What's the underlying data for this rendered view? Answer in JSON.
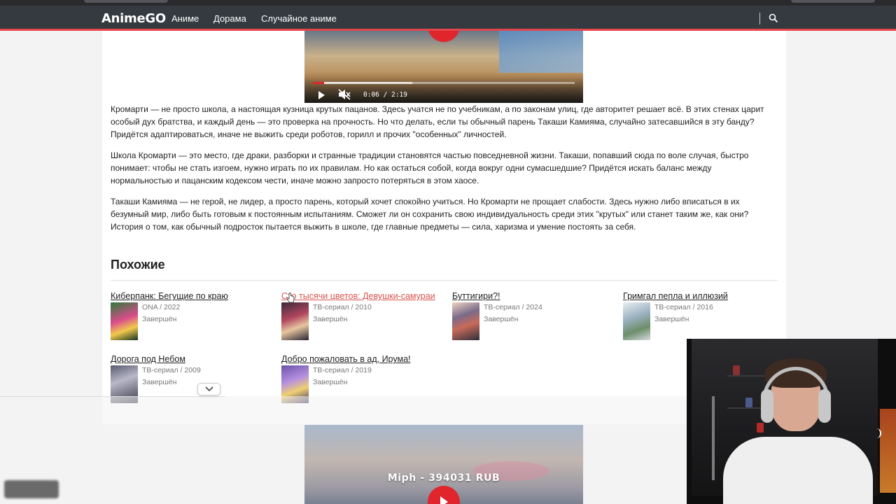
{
  "nav": {
    "brand": "AnimeGO",
    "links": [
      "Аниме",
      "Дорама",
      "Случайное аниме"
    ]
  },
  "player_top": {
    "time": "0:06 / 2:19",
    "progress": 0.043
  },
  "description": [
    "Кромарти — не просто школа, а настоящая кузница крутых пацанов. Здесь учатся не по учебникам, а по законам улиц, где авторитет решает всё. В этих стенах царит особый дух братства, и каждый день — это проверка на прочность. Но что делать, если ты обычный парень Такаши Камияма, случайно затесавшийся в эту банду? Придётся адаптироваться, иначе не выжить среди роботов, горилл и прочих \"особенных\" личностей.",
    "Школа Кромарти — это место, где драки, разборки и странные традиции становятся частью повседневной жизни. Такаши, попавший сюда по воле случая, быстро понимает: чтобы не стать изгоем, нужно играть по их правилам. Но как остаться собой, когда вокруг одни сумасшедшие? Придётся искать баланс между нормальностью и пацанским кодексом чести, иначе можно запросто потеряться в этом хаосе.",
    "Такаши Камияма — не герой, не лидер, а просто парень, который хочет спокойно учиться. Но Кромарти не прощает слабости. Здесь нужно либо вписаться в их безумный мир, либо быть готовым к постоянным испытаниям. Сможет ли он сохранить свою индивидуальность среди этих \"крутых\" или станет таким же, как они? История о том, как обычный подросток пытается выжить в школе, где главные предметы — сила, харизма и умение постоять за себя."
  ],
  "similar": {
    "heading": "Похожие",
    "items": [
      {
        "title": "Киберпанк: Бегущие по краю",
        "meta": "ONA / 2022",
        "status": "Завершён"
      },
      {
        "title": "Сто тысячи цветов: Девушки-самураи",
        "meta": "ТВ-сериал / 2010",
        "status": "Завершён"
      },
      {
        "title": "Буттигири?!",
        "meta": "ТВ-сериал / 2024",
        "status": "Завершён"
      },
      {
        "title": "Гримгал пепла и иллюзий",
        "meta": "ТВ-сериал / 2016",
        "status": "Завершён"
      },
      {
        "title": "Дорога под Небом",
        "meta": "ТВ-сериал / 2009",
        "status": "Завершён"
      },
      {
        "title": "Добро пожаловать в ад, Ирума!",
        "meta": "ТВ-сериал / 2019",
        "status": "Завершён"
      }
    ]
  },
  "donation": "Miph - 394031 RUB",
  "icons": {
    "search": "search-icon",
    "play": "play-icon",
    "mute": "volume-muted-icon",
    "chevron": "chevron-down-icon"
  },
  "colors": {
    "navbar": "#343a40",
    "accent": "#e2454a",
    "link_hover": "#d9534f",
    "player_red": "#e0262c"
  }
}
